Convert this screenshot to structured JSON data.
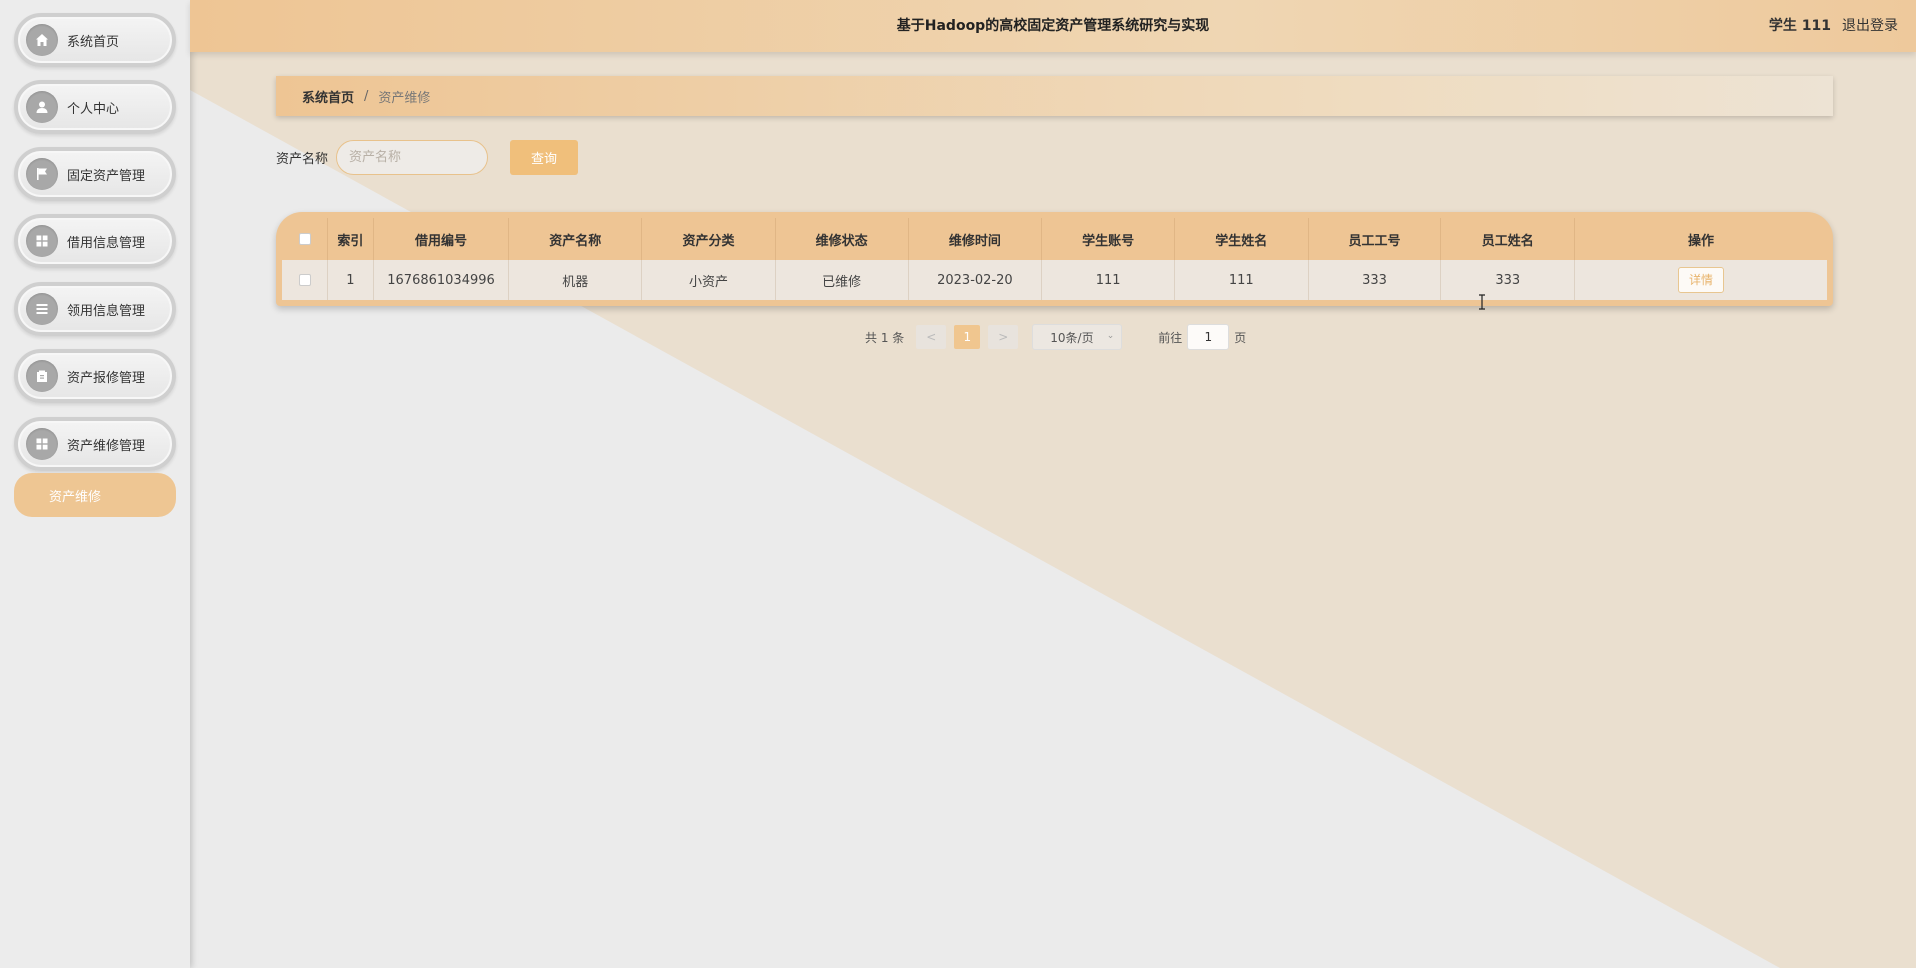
{
  "header": {
    "title": "基于Hadoop的高校固定资产管理系统研究与实现",
    "user": "学生 111",
    "logout": "退出登录"
  },
  "sidebar": {
    "items": [
      {
        "label": "系统首页",
        "icon": "home-icon"
      },
      {
        "label": "个人中心",
        "icon": "user-icon"
      },
      {
        "label": "固定资产管理",
        "icon": "flag-icon"
      },
      {
        "label": "借用信息管理",
        "icon": "grid-icon"
      },
      {
        "label": "领用信息管理",
        "icon": "list-icon"
      },
      {
        "label": "资产报修管理",
        "icon": "clipboard-icon"
      },
      {
        "label": "资产维修管理",
        "icon": "grid-icon"
      }
    ],
    "sub_item": "资产维修"
  },
  "breadcrumb": {
    "home": "系统首页",
    "separator": "/",
    "current": "资产维修"
  },
  "search": {
    "label": "资产名称",
    "placeholder": "资产名称",
    "button": "查询"
  },
  "table": {
    "columns": [
      "索引",
      "借用编号",
      "资产名称",
      "资产分类",
      "维修状态",
      "维修时间",
      "学生账号",
      "学生姓名",
      "员工工号",
      "员工姓名",
      "操作"
    ],
    "rows": [
      {
        "index": "1",
        "borrow_no": "1676861034996",
        "asset_name": "机器",
        "asset_category": "小资产",
        "repair_status": "已维修",
        "repair_time": "2023-02-20",
        "student_account": "111",
        "student_name": "111",
        "staff_no": "333",
        "staff_name": "333",
        "action": "详情"
      }
    ]
  },
  "pagination": {
    "total": "共 1 条",
    "prev": "<",
    "page": "1",
    "next": ">",
    "page_size": "10条/页",
    "goto_label": "前往",
    "goto_value": "1",
    "goto_suffix": "页"
  }
}
